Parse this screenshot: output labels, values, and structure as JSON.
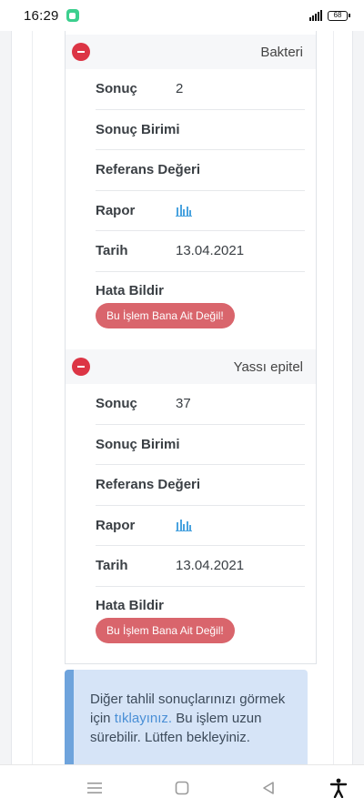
{
  "status_bar": {
    "time": "16:29",
    "battery": "68"
  },
  "sections": [
    {
      "title": "Bakteri",
      "rows": [
        {
          "label": "Sonuç",
          "value": "2"
        },
        {
          "label": "Sonuç Birimi",
          "value": ""
        },
        {
          "label": "Referans Değeri",
          "value": ""
        },
        {
          "label": "Rapor",
          "value": ""
        },
        {
          "label": "Tarih",
          "value": "13.04.2021"
        }
      ],
      "error_label": "Hata Bildir",
      "error_button": "Bu İşlem Bana Ait Değil!"
    },
    {
      "title": "Yassı epitel",
      "rows": [
        {
          "label": "Sonuç",
          "value": "37"
        },
        {
          "label": "Sonuç Birimi",
          "value": ""
        },
        {
          "label": "Referans Değeri",
          "value": ""
        },
        {
          "label": "Rapor",
          "value": ""
        },
        {
          "label": "Tarih",
          "value": "13.04.2021"
        }
      ],
      "error_label": "Hata Bildir",
      "error_button": "Bu İşlem Bana Ait Değil!"
    }
  ],
  "info": {
    "text_before": "Diğer tahlil sonuçlarınızı görmek için ",
    "link": "tıklayınız.",
    "text_after": " Bu işlem uzun sürebilir. Lütfen bekleyiniz."
  },
  "colors": {
    "danger": "#dc3545",
    "error_button": "#d9656c",
    "info_bg": "#d6e4f7",
    "info_border": "#6ea3dc",
    "link": "#4a8fd6"
  }
}
